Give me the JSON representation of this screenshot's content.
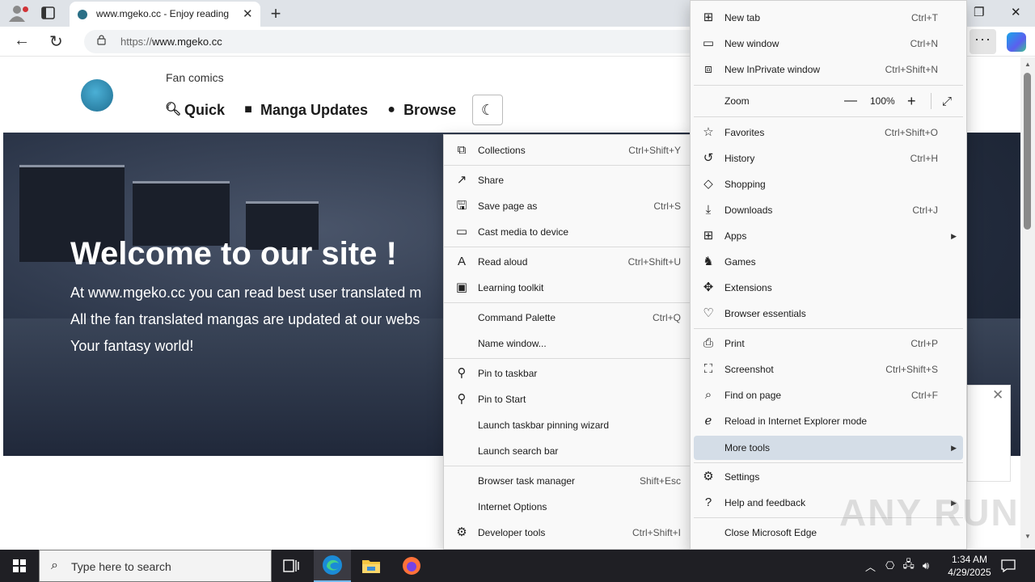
{
  "browser": {
    "tab_title": "www.mgeko.cc - Enjoy reading",
    "url_scheme": "https://",
    "url_host": "www.mgeko.cc",
    "more_label": "···"
  },
  "page": {
    "fan_label": "Fan comics",
    "nav": [
      "Quick",
      "Manga Updates",
      "Browse"
    ],
    "hero_title": "Welcome to our site !",
    "hero_lines": [
      "At www.mgeko.cc you can read best user translated m",
      "All the fan translated mangas are updated at our webs",
      "Your fantasy world!"
    ]
  },
  "main_menu": {
    "items": [
      {
        "label": "New tab",
        "shortcut": "Ctrl+T",
        "icon": "new-tab-icon"
      },
      {
        "label": "New window",
        "shortcut": "Ctrl+N",
        "icon": "new-window-icon"
      },
      {
        "label": "New InPrivate window",
        "shortcut": "Ctrl+Shift+N",
        "icon": "inprivate-icon"
      },
      {
        "label": "Favorites",
        "shortcut": "Ctrl+Shift+O",
        "icon": "star-icon"
      },
      {
        "label": "History",
        "shortcut": "Ctrl+H",
        "icon": "history-icon"
      },
      {
        "label": "Shopping",
        "shortcut": "",
        "icon": "tag-icon"
      },
      {
        "label": "Downloads",
        "shortcut": "Ctrl+J",
        "icon": "download-icon"
      },
      {
        "label": "Apps",
        "shortcut": "",
        "icon": "apps-icon"
      },
      {
        "label": "Games",
        "shortcut": "",
        "icon": "games-icon"
      },
      {
        "label": "Extensions",
        "shortcut": "",
        "icon": "puzzle-icon"
      },
      {
        "label": "Browser essentials",
        "shortcut": "",
        "icon": "heart-pulse-icon"
      },
      {
        "label": "Print",
        "shortcut": "Ctrl+P",
        "icon": "printer-icon"
      },
      {
        "label": "Screenshot",
        "shortcut": "Ctrl+Shift+S",
        "icon": "screenshot-icon"
      },
      {
        "label": "Find on page",
        "shortcut": "Ctrl+F",
        "icon": "find-icon"
      },
      {
        "label": "Reload in Internet Explorer mode",
        "shortcut": "",
        "icon": "ie-icon"
      },
      {
        "label": "More tools",
        "shortcut": "",
        "icon": ""
      },
      {
        "label": "Settings",
        "shortcut": "",
        "icon": "gear-icon"
      },
      {
        "label": "Help and feedback",
        "shortcut": "",
        "icon": "help-icon"
      },
      {
        "label": "Close Microsoft Edge",
        "shortcut": "",
        "icon": ""
      }
    ],
    "zoom_label": "Zoom",
    "zoom_value": "100%",
    "zoom_minus": "—",
    "zoom_plus": "+"
  },
  "more_tools_menu": {
    "items": [
      {
        "label": "Collections",
        "shortcut": "Ctrl+Shift+Y",
        "icon": "collections-icon"
      },
      {
        "label": "Share",
        "shortcut": "",
        "icon": "share-icon"
      },
      {
        "label": "Save page as",
        "shortcut": "Ctrl+S",
        "icon": "save-icon"
      },
      {
        "label": "Cast media to device",
        "shortcut": "",
        "icon": "cast-icon"
      },
      {
        "label": "Read aloud",
        "shortcut": "Ctrl+Shift+U",
        "icon": "read-aloud-icon"
      },
      {
        "label": "Learning toolkit",
        "shortcut": "",
        "icon": "learning-icon"
      },
      {
        "label": "Command Palette",
        "shortcut": "Ctrl+Q",
        "icon": ""
      },
      {
        "label": "Name window...",
        "shortcut": "",
        "icon": ""
      },
      {
        "label": "Pin to taskbar",
        "shortcut": "",
        "icon": "pin-icon"
      },
      {
        "label": "Pin to Start",
        "shortcut": "",
        "icon": "pin-icon"
      },
      {
        "label": "Launch taskbar pinning wizard",
        "shortcut": "",
        "icon": ""
      },
      {
        "label": "Launch search bar",
        "shortcut": "",
        "icon": ""
      },
      {
        "label": "Browser task manager",
        "shortcut": "Shift+Esc",
        "icon": ""
      },
      {
        "label": "Internet Options",
        "shortcut": "",
        "icon": ""
      },
      {
        "label": "Developer tools",
        "shortcut": "Ctrl+Shift+I",
        "icon": "devtools-icon"
      }
    ]
  },
  "taskbar": {
    "search_placeholder": "Type here to search",
    "time": "1:34 AM",
    "date": "4/29/2025"
  },
  "watermark": "ANY RUN",
  "colors": {
    "menu_bg": "#f9f9f9",
    "menu_highlight": "#d4dde7",
    "taskbar": "#1f1f24",
    "accent": "#76b9ed"
  }
}
